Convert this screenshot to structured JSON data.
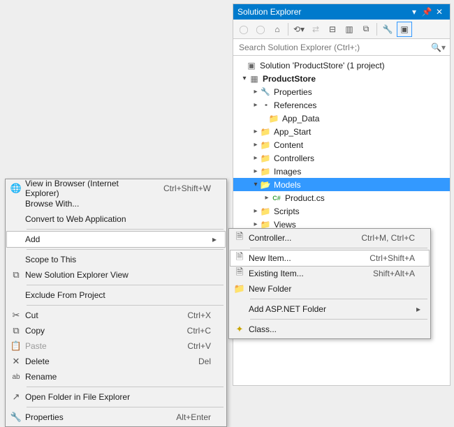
{
  "panel": {
    "title": "Solution Explorer",
    "search_placeholder": "Search Solution Explorer (Ctrl+;)"
  },
  "tree": {
    "solution_label": "Solution 'ProductStore' (1 project)",
    "project": "ProductStore",
    "properties": "Properties",
    "references": "References",
    "app_data": "App_Data",
    "app_start": "App_Start",
    "content": "Content",
    "controllers": "Controllers",
    "images": "Images",
    "models": "Models",
    "product_cs": "Product.cs",
    "scripts": "Scripts",
    "views": "Views"
  },
  "ctx": {
    "view_browser": "View in Browser (Internet Explorer)",
    "view_browser_sc": "Ctrl+Shift+W",
    "browse_with": "Browse With...",
    "convert_web": "Convert to Web Application",
    "add": "Add",
    "scope": "Scope to This",
    "new_view": "New Solution Explorer View",
    "exclude": "Exclude From Project",
    "cut": "Cut",
    "cut_sc": "Ctrl+X",
    "copy": "Copy",
    "copy_sc": "Ctrl+C",
    "paste": "Paste",
    "paste_sc": "Ctrl+V",
    "delete": "Delete",
    "delete_sc": "Del",
    "rename": "Rename",
    "open_folder": "Open Folder in File Explorer",
    "properties": "Properties",
    "properties_sc": "Alt+Enter"
  },
  "add_sub": {
    "controller": "Controller...",
    "controller_sc": "Ctrl+M, Ctrl+C",
    "new_item": "New Item...",
    "new_item_sc": "Ctrl+Shift+A",
    "existing": "Existing Item...",
    "existing_sc": "Shift+Alt+A",
    "new_folder": "New Folder",
    "aspnet_folder": "Add ASP.NET Folder",
    "class": "Class..."
  }
}
